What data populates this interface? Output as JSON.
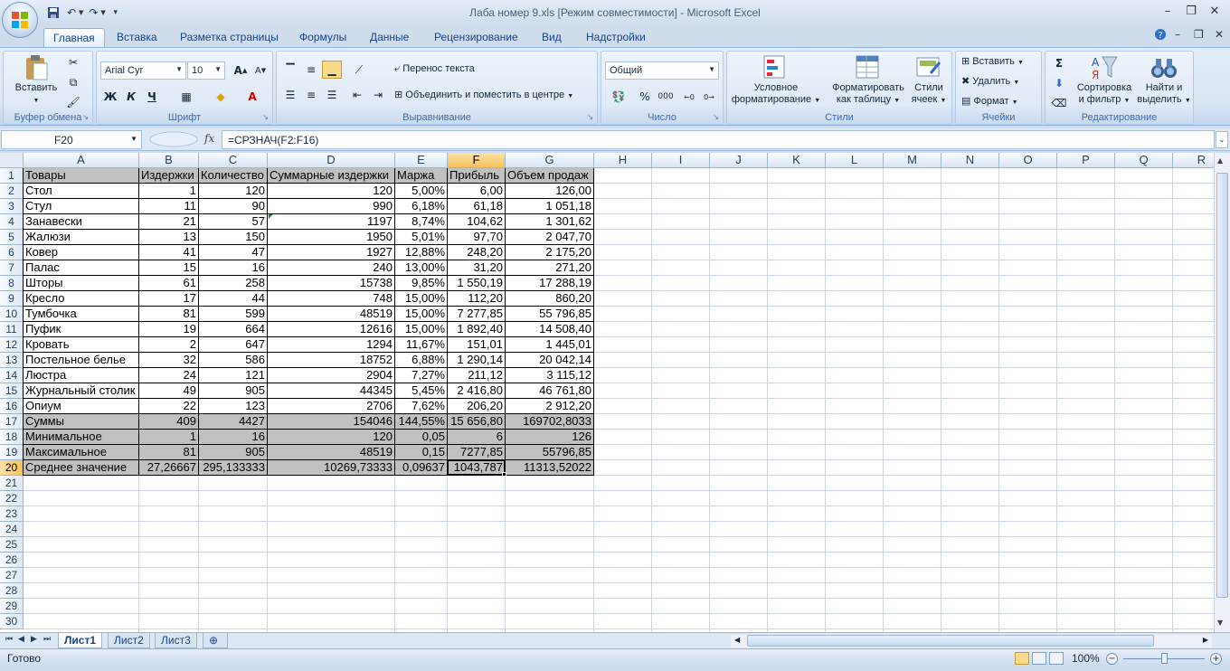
{
  "app": {
    "window_title": "Лаба номер 9.xls  [Режим совместимости] - Microsoft Excel"
  },
  "ribbon": {
    "tabs": [
      "Главная",
      "Вставка",
      "Разметка страницы",
      "Формулы",
      "Данные",
      "Рецензирование",
      "Вид",
      "Надстройки"
    ],
    "active_tab": "Главная",
    "clipboard": {
      "paste": "Вставить",
      "group_label": "Буфер обмена"
    },
    "font": {
      "name": "Arial Cyr",
      "size": "10",
      "group_label": "Шрифт",
      "bold": "Ж",
      "italic": "К",
      "underline": "Ч"
    },
    "alignment": {
      "wrap_text": "Перенос текста",
      "merge_center": "Объединить и поместить в центре",
      "group_label": "Выравнивание"
    },
    "number": {
      "format": "Общий",
      "percent": "%",
      "thousands": "000",
      "group_label": "Число"
    },
    "styles": {
      "conditional": [
        "Условное",
        "форматирование"
      ],
      "format_table": [
        "Форматировать",
        "как таблицу"
      ],
      "cell_styles": [
        "Стили",
        "ячеек"
      ],
      "group_label": "Стили"
    },
    "cells": {
      "insert": "Вставить",
      "delete": "Удалить",
      "format": "Формат",
      "group_label": "Ячейки"
    },
    "editing": {
      "sort_filter": [
        "Сортировка",
        "и фильтр"
      ],
      "find_select": [
        "Найти и",
        "выделить"
      ],
      "group_label": "Редактирование"
    }
  },
  "formula_bar": {
    "name_box": "F20",
    "fx": "fx",
    "formula": "=СРЗНАЧ(F2:F16)"
  },
  "sheet": {
    "columns": [
      "A",
      "B",
      "C",
      "D",
      "E",
      "F",
      "G",
      "H",
      "I",
      "J",
      "K",
      "L",
      "M",
      "N",
      "O",
      "P",
      "Q",
      "R"
    ],
    "row_numbers": [
      "1",
      "2",
      "3",
      "4",
      "5",
      "6",
      "7",
      "8",
      "9",
      "10",
      "11",
      "12",
      "13",
      "14",
      "15",
      "16",
      "17",
      "18",
      "19",
      "20",
      "21",
      "22",
      "23",
      "24",
      "25",
      "26",
      "27",
      "28",
      "29",
      "30"
    ],
    "selected_cell": "F20",
    "rows": [
      [
        "Товары",
        "Издержки",
        "Количество",
        "Суммарные издержки",
        "Маржа",
        "Прибыль",
        "Объем продаж"
      ],
      [
        "Стол",
        "1",
        "120",
        "120",
        "5,00%",
        "6,00",
        "126,00"
      ],
      [
        "Стул",
        "11",
        "90",
        "990",
        "6,18%",
        "61,18",
        "1 051,18"
      ],
      [
        "Занавески",
        "21",
        "57",
        "1197",
        "8,74%",
        "104,62",
        "1 301,62"
      ],
      [
        "Жалюзи",
        "13",
        "150",
        "1950",
        "5,01%",
        "97,70",
        "2 047,70"
      ],
      [
        "Ковер",
        "41",
        "47",
        "1927",
        "12,88%",
        "248,20",
        "2 175,20"
      ],
      [
        "Палас",
        "15",
        "16",
        "240",
        "13,00%",
        "31,20",
        "271,20"
      ],
      [
        "Шторы",
        "61",
        "258",
        "15738",
        "9,85%",
        "1 550,19",
        "17 288,19"
      ],
      [
        "Кресло",
        "17",
        "44",
        "748",
        "15,00%",
        "112,20",
        "860,20"
      ],
      [
        "Тумбочка",
        "81",
        "599",
        "48519",
        "15,00%",
        "7 277,85",
        "55 796,85"
      ],
      [
        "Пуфик",
        "19",
        "664",
        "12616",
        "15,00%",
        "1 892,40",
        "14 508,40"
      ],
      [
        "Кровать",
        "2",
        "647",
        "1294",
        "11,67%",
        "151,01",
        "1 445,01"
      ],
      [
        "Постельное белье",
        "32",
        "586",
        "18752",
        "6,88%",
        "1 290,14",
        "20 042,14"
      ],
      [
        "Люстра",
        "24",
        "121",
        "2904",
        "7,27%",
        "211,12",
        "3 115,12"
      ],
      [
        "Журнальный столик",
        "49",
        "905",
        "44345",
        "5,45%",
        "2 416,80",
        "46 761,80"
      ],
      [
        "Опиум",
        "22",
        "123",
        "2706",
        "7,62%",
        "206,20",
        "2 912,20"
      ],
      [
        "Суммы",
        "409",
        "4427",
        "154046",
        "144,55%",
        "15 656,80",
        "169702,8033"
      ],
      [
        "Минимальное",
        "1",
        "16",
        "120",
        "0,05",
        "6",
        "126"
      ],
      [
        "Максимальное",
        "81",
        "905",
        "48519",
        "0,15",
        "7277,85",
        "55796,85"
      ],
      [
        "Среднее значение",
        "27,26667",
        "295,133333",
        "10269,73333",
        "0,09637",
        "1043,787",
        "11313,52022"
      ]
    ]
  },
  "sheet_tabs": [
    "Лист1",
    "Лист2",
    "Лист3"
  ],
  "active_sheet": "Лист1",
  "status": {
    "text": "Готово",
    "zoom": "100%"
  }
}
